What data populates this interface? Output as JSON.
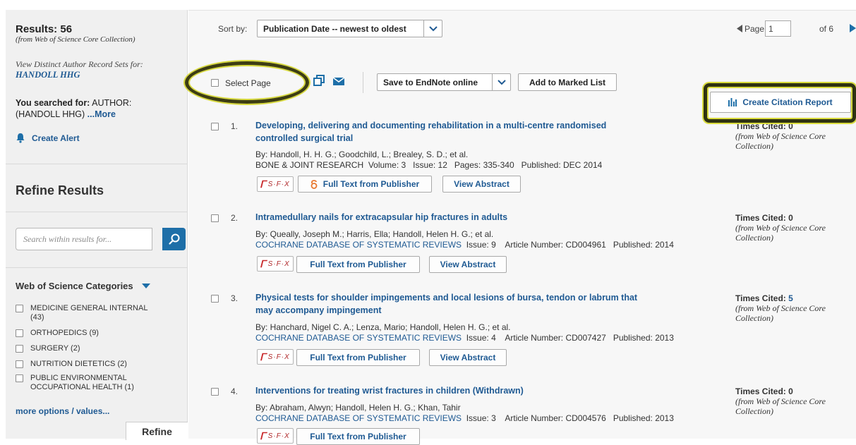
{
  "sidebar": {
    "results_label": "Results: 56",
    "results_sub": "(from Web of Science Core Collection)",
    "view_distinct": "View Distinct Author Record Sets for:",
    "author_link": "HANDOLL HHG",
    "you_searched_label": "You searched for:",
    "you_searched_value": "AUTHOR:",
    "you_searched_value2": "(HANDOLL HHG)",
    "more_link": "...More",
    "create_alert": "Create Alert",
    "refine_title": "Refine Results",
    "search_placeholder": "Search within results for...",
    "categories_title": "Web of Science Categories",
    "categories": [
      {
        "line1": "MEDICINE GENERAL INTERNAL",
        "line2": "(43)"
      },
      {
        "line1": "ORTHOPEDICS (9)",
        "line2": ""
      },
      {
        "line1": "SURGERY (2)",
        "line2": ""
      },
      {
        "line1": "NUTRITION DIETETICS (2)",
        "line2": ""
      },
      {
        "line1": "PUBLIC ENVIRONMENTAL",
        "line2": "OCCUPATIONAL HEALTH (1)"
      }
    ],
    "more_options": "more options / values...",
    "refine_button": "Refine"
  },
  "toolbar": {
    "sort_label": "Sort by:",
    "sort_value": "Publication Date -- newest to oldest",
    "page_label": "Page",
    "page_value": "1",
    "page_of": "of 6",
    "select_page": "Select Page",
    "save_endnote": "Save to EndNote online",
    "add_marked": "Add to Marked List",
    "create_citation": "Create Citation Report"
  },
  "records": [
    {
      "num": "1.",
      "title_l1": "Developing, delivering and documenting rehabilitation in a multi-centre randomised",
      "title_l2": "controlled surgical trial",
      "authors": "By: Handoll, H. H. G.; Goodchild, L.; Brealey, S. D.; et al.",
      "source": "BONE & JOINT RESEARCH",
      "details": "Volume: 3   Issue: 12   Pages: 335-340   Published: DEC 2014",
      "times_cited": "Times Cited: 0",
      "tc_src": "(from Web of Science Core Collection)",
      "sfx": "S·F·X",
      "fulltext": "Full Text from Publisher",
      "abstract": "View Abstract"
    },
    {
      "num": "2.",
      "title_l1": "Intramedullary nails for extracapsular hip fractures in adults",
      "title_l2": "",
      "authors": "By: Queally, Joseph M.; Harris, Ella; Handoll, Helen H. G.; et al.",
      "source": "COCHRANE DATABASE OF SYSTEMATIC REVIEWS",
      "details": "Issue: 9    Article Number: CD004961   Published: 2014",
      "times_cited": "Times Cited: 0",
      "tc_src": "(from Web of Science Core Collection)",
      "sfx": "S·F·X",
      "fulltext": "Full Text from Publisher",
      "abstract": "View Abstract"
    },
    {
      "num": "3.",
      "title_l1": "Physical tests for shoulder impingements and local lesions of bursa, tendon or labrum that",
      "title_l2": "may accompany impingement",
      "authors": "By: Hanchard, Nigel C. A.; Lenza, Mario; Handoll, Helen H. G.; et al.",
      "source": "COCHRANE DATABASE OF SYSTEMATIC REVIEWS",
      "details": "Issue: 4    Article Number: CD007427   Published: 2013",
      "times_cited_label": "Times Cited:",
      "times_cited_value": "5",
      "tc_src": "(from Web of Science Core Collection)",
      "sfx": "S·F·X",
      "fulltext": "Full Text from Publisher",
      "abstract": "View Abstract"
    },
    {
      "num": "4.",
      "title_l1": "Interventions for treating wrist fractures in children (Withdrawn)",
      "title_l2": "",
      "authors": "By: Abraham, Alwyn; Handoll, Helen H. G.; Khan, Tahir",
      "source": "COCHRANE DATABASE OF SYSTEMATIC REVIEWS",
      "details": "Issue: 3    Article Number: CD004576   Published: 2013",
      "times_cited": "Times Cited: 0",
      "tc_src": "(from Web of Science Core Collection)",
      "sfx": "S·F·X",
      "fulltext": "Full Text from Publisher"
    }
  ],
  "colors": {
    "link": "#1f5a93",
    "search_button": "#1e6fa8",
    "highlight": "#d7d93a"
  }
}
